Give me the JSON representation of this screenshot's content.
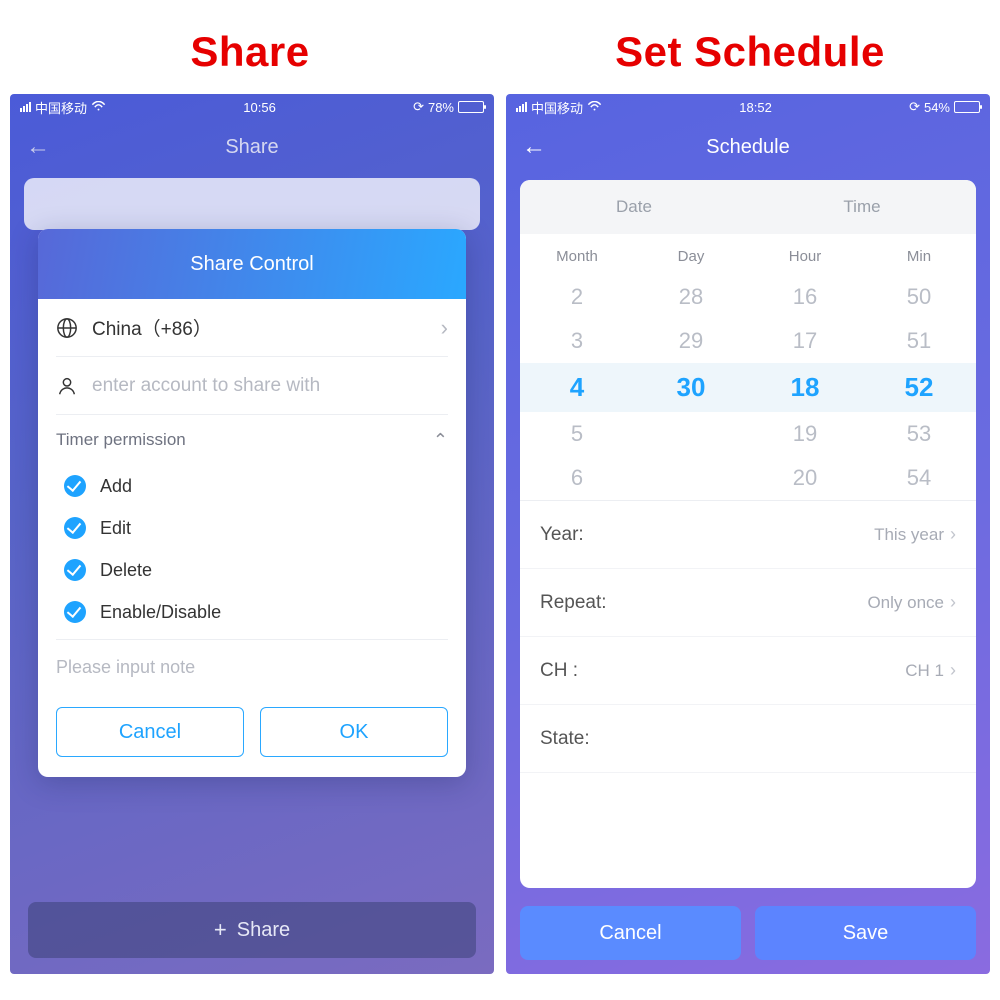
{
  "captions": {
    "left": "Share",
    "right": "Set Schedule"
  },
  "left": {
    "status": {
      "carrier": "中国移动",
      "time": "10:56",
      "battery_pct": "78%",
      "battery_fill": 78
    },
    "nav": {
      "title": "Share"
    },
    "dialog": {
      "title": "Share Control",
      "country": "China（+86）",
      "account_placeholder": "enter account to share with",
      "perm_section": "Timer permission",
      "perms": [
        "Add",
        "Edit",
        "Delete",
        "Enable/Disable"
      ],
      "note_placeholder": "Please input note",
      "cancel": "Cancel",
      "ok": "OK"
    },
    "bottom_share": "Share"
  },
  "right": {
    "status": {
      "carrier": "中国移动",
      "time": "18:52",
      "battery_pct": "54%",
      "battery_fill": 54
    },
    "nav": {
      "title": "Schedule"
    },
    "tabs": {
      "date": "Date",
      "time": "Time"
    },
    "picker": {
      "headers": [
        "Month",
        "Day",
        "Hour",
        "Min"
      ],
      "rows": [
        [
          "2",
          "28",
          "16",
          "50"
        ],
        [
          "3",
          "29",
          "17",
          "51"
        ],
        [
          "4",
          "30",
          "18",
          "52"
        ],
        [
          "5",
          "",
          "19",
          "53"
        ],
        [
          "6",
          "",
          "20",
          "54"
        ]
      ],
      "selected_index": 2
    },
    "settings": {
      "year_label": "Year:",
      "year_value": "This year",
      "repeat_label": "Repeat:",
      "repeat_value": "Only once",
      "ch_label": "CH :",
      "ch_value": "CH 1",
      "state_label": "State:",
      "state_value": ""
    },
    "actions": {
      "cancel": "Cancel",
      "save": "Save"
    }
  }
}
